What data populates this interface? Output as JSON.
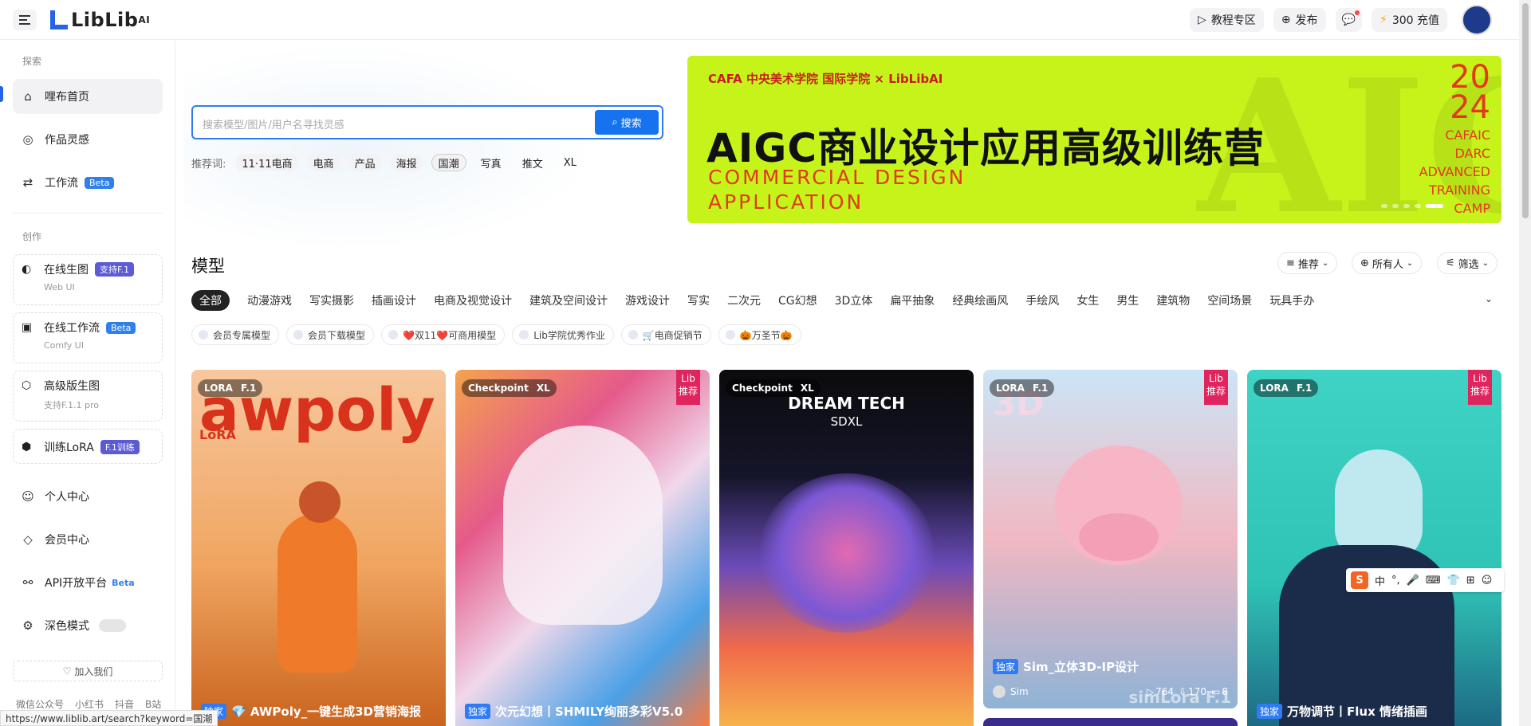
{
  "app": {
    "logo_text": "LibLib",
    "logo_sup": "AI"
  },
  "header": {
    "tutorial": "教程专区",
    "publish": "发布",
    "recharge": "300 充值"
  },
  "sidebar": {
    "explore_title": "探索",
    "items_explore": [
      {
        "label": "哩布首页",
        "icon": "home-icon"
      },
      {
        "label": "作品灵感",
        "icon": "bulb-icon"
      },
      {
        "label": "工作流",
        "icon": "workflow-icon",
        "badge": "Beta"
      }
    ],
    "create_title": "创作",
    "cards": [
      {
        "label": "在线生图",
        "badge": "支持F.1",
        "sub": "Web UI",
        "icon": "palette-icon"
      },
      {
        "label": "在线工作流",
        "badge": "Beta",
        "sub": "Comfy UI",
        "icon": "comfy-icon"
      },
      {
        "label": "高级版生图",
        "sub": "支持F.1.1 pro",
        "icon": "cube-icon"
      }
    ],
    "train_lora": {
      "label": "训练LoRA",
      "badge": "F.1训练"
    },
    "personal": "个人中心",
    "member": "会员中心",
    "api": {
      "label": "API开放平台",
      "badge": "Beta"
    },
    "dark_mode": "深色模式",
    "join": "加入我们",
    "footer_links": [
      "微信公众号",
      "小红书",
      "抖音",
      "B站"
    ]
  },
  "status_url": "https://www.liblib.art/search?keyword=国潮",
  "search": {
    "placeholder": "搜索模型/图片/用户名寻找灵感",
    "button": "搜索",
    "rec_label": "推荐词:",
    "rec_words": [
      "11·11电商",
      "电商",
      "产品",
      "海报",
      "国潮",
      "写真",
      "推文",
      "XL"
    ]
  },
  "banner": {
    "logos": "CAFA 中央美术学院 国际学院 × LibLibAI",
    "title": "AIGC商业设计应用高级训练营",
    "subtitle": "COMMERCIAL DESIGN APPLICATION",
    "year": "2024",
    "camp": "CAFAIC DARC ADVANCED TRAINING CAMP"
  },
  "models": {
    "title": "模型",
    "sort": "推荐",
    "owner": "所有人",
    "filter": "筛选",
    "categories": [
      "全部",
      "动漫游戏",
      "写实摄影",
      "插画设计",
      "电商及视觉设计",
      "建筑及空间设计",
      "游戏设计",
      "写实",
      "二次元",
      "CG幻想",
      "3D立体",
      "扁平抽象",
      "经典绘画风",
      "手绘风",
      "女生",
      "男生",
      "建筑物",
      "空间场景",
      "玩具手办"
    ],
    "tags": [
      "会员专属模型",
      "会员下载模型",
      "❤️双11❤️可商用模型",
      "Lib学院优秀作业",
      "🛒电商促销节",
      "🎃万圣节🎃"
    ]
  },
  "cards": [
    {
      "type": "LORA",
      "base": "F.1",
      "title": "💎 AWPoly_一键生成3D营销海报",
      "exclusive": "独家",
      "art": "awpoly",
      "art_sub": "LoRA"
    },
    {
      "type": "Checkpoint",
      "base": "XL",
      "title": "次元幻想丨SHMILY绚丽多彩V5.0",
      "exclusive": "独家",
      "ribbon": "Lib 推荐"
    },
    {
      "type": "Checkpoint",
      "base": "XL",
      "art": "DREAM TECH",
      "art_sub": "SDXL"
    },
    {
      "type": "LORA",
      "base": "F.1",
      "title": "Sim_立体3D-IP设计",
      "exclusive": "独家",
      "ribbon": "Lib 推荐",
      "author": "Sim",
      "views": "764",
      "downloads": "170",
      "comments": "8",
      "art": "3D",
      "watermark": "simLora  F.1"
    },
    {
      "type": "LORA",
      "base": "F.1",
      "title": "万物调节丨Flux 情绪插画",
      "exclusive": "独家",
      "ribbon": "Lib 推荐"
    }
  ],
  "ime": {
    "logo": "S",
    "lang": "中"
  }
}
